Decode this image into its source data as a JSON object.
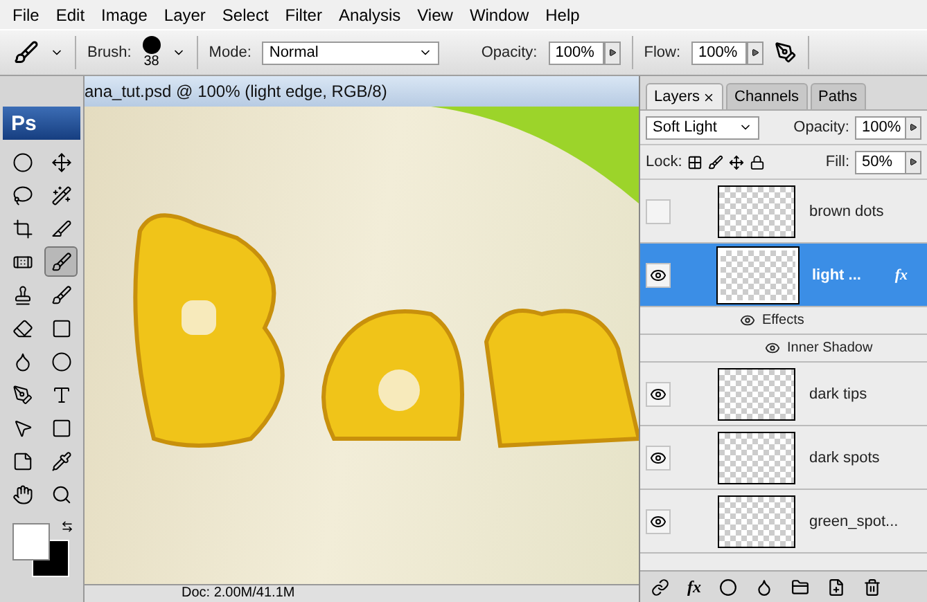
{
  "menu": [
    "File",
    "Edit",
    "Image",
    "Layer",
    "Select",
    "Filter",
    "Analysis",
    "View",
    "Window",
    "Help"
  ],
  "options_bar": {
    "brush_label": "Brush:",
    "brush_size": "38",
    "mode_label": "Mode:",
    "mode": "Normal",
    "opacity_label": "Opacity:",
    "opacity": "100%",
    "flow_label": "Flow:",
    "flow": "100%"
  },
  "toolbox": {
    "logo": "Ps"
  },
  "document": {
    "title": "ana_tut.psd @ 100% (light edge, RGB/8)",
    "status": "Doc: 2.00M/41.1M"
  },
  "layers_panel": {
    "tabs": [
      {
        "label": "Layers",
        "selected": true
      },
      {
        "label": "Channels",
        "selected": false
      },
      {
        "label": "Paths",
        "selected": false
      }
    ],
    "blend_mode": "Soft Light",
    "opacity_label": "Opacity:",
    "opacity": "100%",
    "lock_label": "Lock:",
    "fill_label": "Fill:",
    "fill": "50%",
    "layers": [
      {
        "name": "brown dots",
        "visible": false,
        "selected": false
      },
      {
        "name": "light ...",
        "visible": true,
        "selected": true,
        "fx_badge": "fx",
        "effects": {
          "label": "Effects",
          "visible": true,
          "children": [
            {
              "label": "Inner Shadow",
              "visible": true
            }
          ]
        }
      },
      {
        "name": "dark tips",
        "visible": true,
        "selected": false
      },
      {
        "name": "dark spots",
        "visible": true,
        "selected": false
      },
      {
        "name": "green_spot...",
        "visible": true,
        "selected": false
      }
    ],
    "fx_button": "fx"
  }
}
